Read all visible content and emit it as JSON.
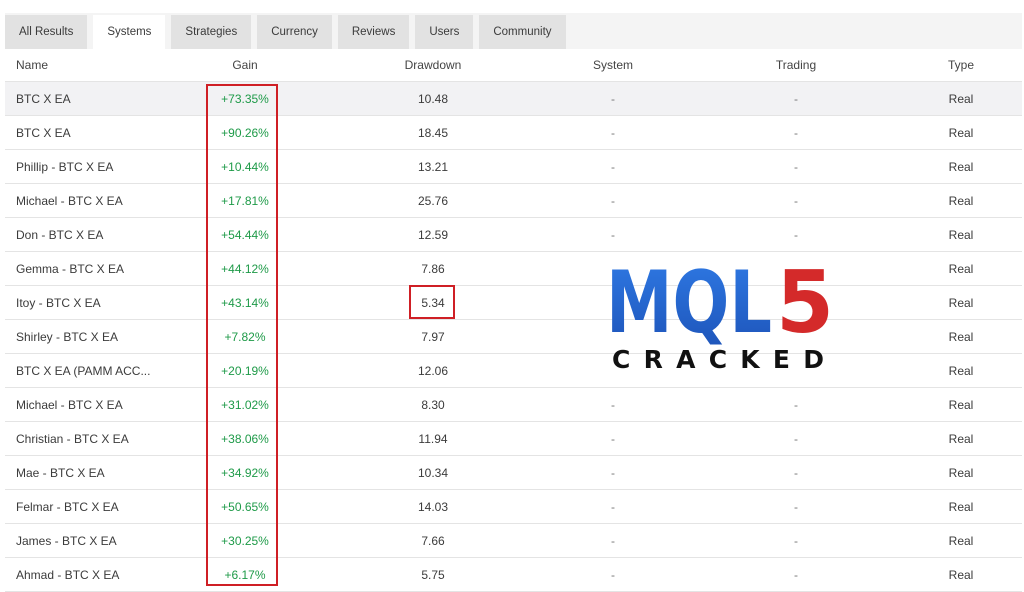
{
  "tabs": [
    {
      "label": "All Results",
      "active": false
    },
    {
      "label": "Systems",
      "active": true
    },
    {
      "label": "Strategies",
      "active": false
    },
    {
      "label": "Currency",
      "active": false
    },
    {
      "label": "Reviews",
      "active": false
    },
    {
      "label": "Users",
      "active": false
    },
    {
      "label": "Community",
      "active": false
    }
  ],
  "table": {
    "headers": {
      "name": "Name",
      "gain": "Gain",
      "drawdown": "Drawdown",
      "system": "System",
      "trading": "Trading",
      "type": "Type"
    },
    "rows": [
      {
        "name": "BTC X EA",
        "gain": "+73.35%",
        "drawdown": "10.48",
        "system": "-",
        "trading": "-",
        "type": "Real"
      },
      {
        "name": "BTC X EA",
        "gain": "+90.26%",
        "drawdown": "18.45",
        "system": "-",
        "trading": "-",
        "type": "Real"
      },
      {
        "name": "Phillip - BTC X EA",
        "gain": "+10.44%",
        "drawdown": "13.21",
        "system": "-",
        "trading": "-",
        "type": "Real"
      },
      {
        "name": "Michael - BTC X EA",
        "gain": "+17.81%",
        "drawdown": "25.76",
        "system": "-",
        "trading": "-",
        "type": "Real"
      },
      {
        "name": "Don - BTC X EA",
        "gain": "+54.44%",
        "drawdown": "12.59",
        "system": "-",
        "trading": "-",
        "type": "Real"
      },
      {
        "name": "Gemma - BTC X EA",
        "gain": "+44.12%",
        "drawdown": "7.86",
        "system": "",
        "trading": "",
        "type": "Real"
      },
      {
        "name": "Itoy - BTC X EA",
        "gain": "+43.14%",
        "drawdown": "5.34",
        "system": "",
        "trading": "",
        "type": "Real"
      },
      {
        "name": "Shirley - BTC X EA",
        "gain": "+7.82%",
        "drawdown": "7.97",
        "system": "",
        "trading": "",
        "type": "Real"
      },
      {
        "name": "BTC X EA (PAMM ACC...",
        "gain": "+20.19%",
        "drawdown": "12.06",
        "system": "",
        "trading": "",
        "type": "Real"
      },
      {
        "name": "Michael - BTC X EA",
        "gain": "+31.02%",
        "drawdown": "8.30",
        "system": "-",
        "trading": "-",
        "type": "Real"
      },
      {
        "name": "Christian - BTC X EA",
        "gain": "+38.06%",
        "drawdown": "11.94",
        "system": "-",
        "trading": "-",
        "type": "Real"
      },
      {
        "name": "Mae - BTC X EA",
        "gain": "+34.92%",
        "drawdown": "10.34",
        "system": "-",
        "trading": "-",
        "type": "Real"
      },
      {
        "name": "Felmar - BTC X EA",
        "gain": "+50.65%",
        "drawdown": "14.03",
        "system": "-",
        "trading": "-",
        "type": "Real"
      },
      {
        "name": "James - BTC X EA",
        "gain": "+30.25%",
        "drawdown": "7.66",
        "system": "-",
        "trading": "-",
        "type": "Real"
      },
      {
        "name": "Ahmad - BTC X EA",
        "gain": "+6.17%",
        "drawdown": "5.75",
        "system": "-",
        "trading": "-",
        "type": "Real"
      }
    ]
  },
  "logo": {
    "main": "MQL5",
    "sub": "CRACKED"
  },
  "colors": {
    "gain": "#1e9a48",
    "highlight_box": "#cf1f25",
    "logo_blue": "#2d6fd6",
    "logo_red": "#d42a2a"
  }
}
